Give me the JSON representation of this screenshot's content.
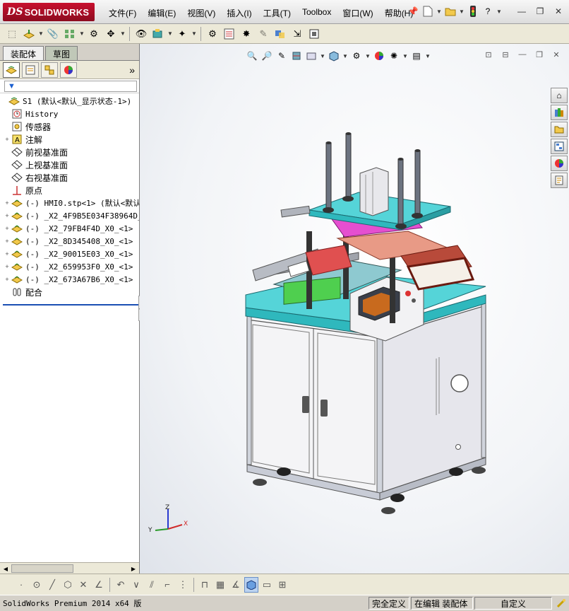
{
  "app": {
    "brand": "SOLIDWORKS",
    "brand_prefix": "DS"
  },
  "menu": [
    "文件(F)",
    "编辑(E)",
    "视图(V)",
    "插入(I)",
    "工具(T)",
    "Toolbox",
    "窗口(W)",
    "帮助(H)"
  ],
  "title_tools": {
    "help_label": "?"
  },
  "left_panel": {
    "tabs": [
      "装配体",
      "草图"
    ],
    "more_symbol": "»",
    "tree": [
      {
        "label": "S1  (默认<默认_显示状态-1>)",
        "icon": "assembly-icon",
        "expander": ""
      },
      {
        "label": "History",
        "icon": "history-icon",
        "expander": ""
      },
      {
        "label": "传感器",
        "icon": "sensor-icon",
        "expander": ""
      },
      {
        "label": "注解",
        "icon": "annotation-icon",
        "expander": "+"
      },
      {
        "label": "前视基准面",
        "icon": "plane-icon",
        "expander": ""
      },
      {
        "label": "上视基准面",
        "icon": "plane-icon",
        "expander": ""
      },
      {
        "label": "右视基准面",
        "icon": "plane-icon",
        "expander": ""
      },
      {
        "label": "原点",
        "icon": "origin-icon",
        "expander": ""
      },
      {
        "label": "(-) HMI0.stp<1> (默认<默认",
        "icon": "part-icon",
        "expander": "+"
      },
      {
        "label": "(-) _X2_4F9B5E034F38964D_X",
        "icon": "part-icon",
        "expander": "+"
      },
      {
        "label": "(-) _X2_79FB4F4D_X0_<1> (",
        "icon": "part-icon",
        "expander": "+"
      },
      {
        "label": "(-) _X2_8D345408_X0_<1> (",
        "icon": "part-icon",
        "expander": "+"
      },
      {
        "label": "(-) _X2_90015E03_X0_<1> (",
        "icon": "part-icon",
        "expander": "+"
      },
      {
        "label": "(-) _X2_659953F0_X0_<1> (",
        "icon": "part-icon",
        "expander": "+"
      },
      {
        "label": "(-) _X2_673A67B6_X0_<1> (",
        "icon": "part-icon",
        "expander": "+"
      },
      {
        "label": "配合",
        "icon": "mates-icon",
        "expander": ""
      }
    ]
  },
  "triad": {
    "x": "X",
    "y": "Y",
    "z": "Z"
  },
  "status": {
    "product": "SolidWorks Premium 2014 x64 版",
    "defined": "完全定义",
    "editing": "在编辑 装配体",
    "units": "自定义"
  },
  "colors": {
    "brand_red": "#c8102e",
    "accent_blue": "#1a4fb4",
    "machine_cyan": "#3fc4c8"
  }
}
